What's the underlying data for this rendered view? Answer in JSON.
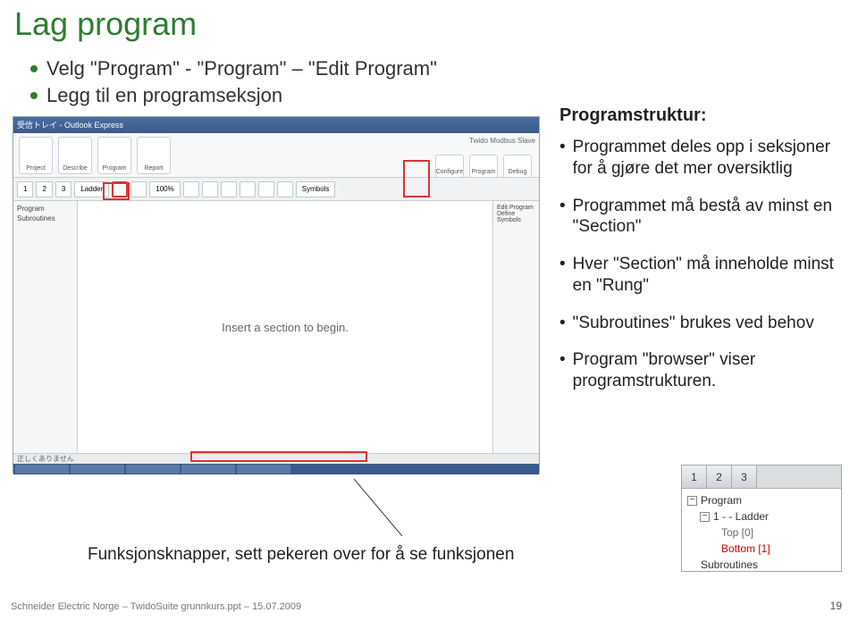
{
  "title": "Lag program",
  "bullets": [
    "Velg \"Program\" - \"Program\" – \"Edit Program\"",
    "Legg til en programseksjon"
  ],
  "screenshot": {
    "titlebar": "受信トレイ - Outlook Express",
    "top_icons": [
      "Project",
      "Describe",
      "Program",
      "Report"
    ],
    "top_right": "Twido Modbus Slave",
    "right_icons": [
      "Configure",
      "Program",
      "Debug"
    ],
    "toolbar_tabs": [
      "1",
      "2",
      "3"
    ],
    "toolbar_items": [
      "Ladder",
      "100%",
      "Symbols"
    ],
    "left_panel": [
      "Program",
      "Subroutines"
    ],
    "right_panel": [
      "Edit Program",
      "Define Symbols"
    ],
    "main_text": "Insert a section to begin.",
    "status": "正しくありません"
  },
  "right": {
    "heading": "Programstruktur:",
    "items": [
      "Programmet deles opp i seksjoner for å gjøre det mer oversiktlig",
      "Programmet må bestå av minst en \"Section\"",
      "Hver \"Section\" må inneholde minst en \"Rung\"",
      "\"Subroutines\" brukes ved behov",
      "Program \"browser\" viser programstrukturen."
    ]
  },
  "callout": "Funksjonsknapper, sett pekeren over for å se funksjonen",
  "tree": {
    "tabs": [
      "1",
      "2",
      "3"
    ],
    "root": "Program",
    "node": "1 -  - Ladder",
    "children": [
      "Top [0]",
      "Bottom [1]"
    ],
    "subroutines": "Subroutines"
  },
  "footer": "Schneider Electric Norge – TwidoSuite grunnkurs.ppt – 15.07.2009",
  "page": "19"
}
